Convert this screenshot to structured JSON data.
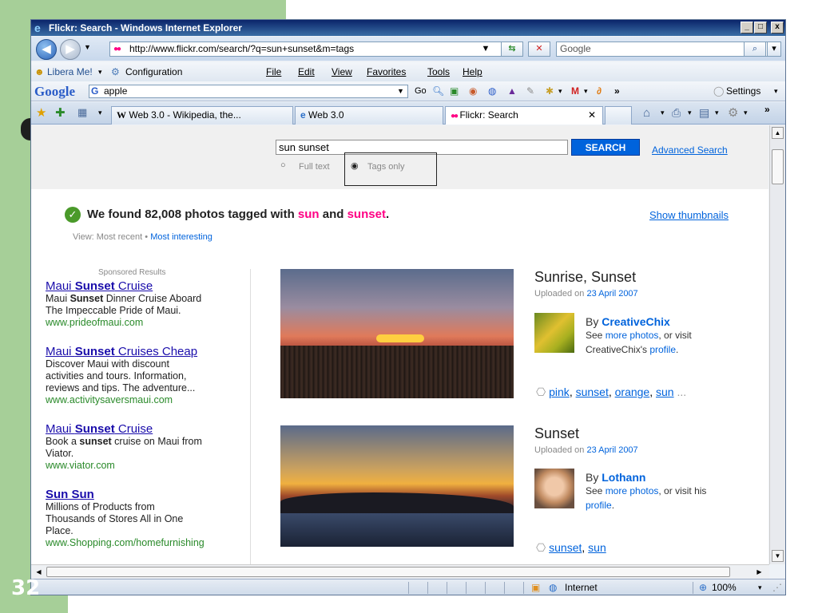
{
  "slide": {
    "number": "32"
  },
  "window": {
    "title": "Flickr: Search - Windows Internet Explorer",
    "minimize": "_",
    "maximize": "□",
    "close": "x"
  },
  "address": {
    "url": "http://www.flickr.com/search/?q=sun+sunset&m=tags",
    "search_placeholder": "Google"
  },
  "links_bar": {
    "libera": "Libera Me!",
    "configuration": "Configuration",
    "menu": [
      "File",
      "Edit",
      "View",
      "Favorites",
      "Tools",
      "Help"
    ]
  },
  "google_toolbar": {
    "logo": "Google",
    "query": "apple",
    "go": "Go",
    "more": "»",
    "settings": "Settings"
  },
  "tabs": [
    {
      "label": "Web 3.0 - Wikipedia, the..."
    },
    {
      "label": "Web 3.0"
    },
    {
      "label": "Flickr: Search"
    }
  ],
  "search": {
    "query": "sun sunset",
    "button": "SEARCH",
    "advanced": "Advanced Search",
    "option_full": "Full text",
    "option_tags": "Tags only",
    "selected_option": "Tags only"
  },
  "results": {
    "prefix": "We found 82,008 photos tagged with ",
    "tag1": "sun",
    "and": " and ",
    "tag2": "sunset",
    "period": ".",
    "show_thumbnails": "Show thumbnails",
    "view_label": "View: Most recent",
    "view_sep": " • ",
    "view_interesting": "Most interesting"
  },
  "sponsored": {
    "heading": "Sponsored Results",
    "ads": [
      {
        "title_pre": "Maui ",
        "title_bold": "Sunset",
        "title_post": " Cruise",
        "line1_pre": "Maui ",
        "line1_bold": "Sunset",
        "line1_post": " Dinner Cruise Aboard",
        "line2": "The Impeccable Pride of Maui.",
        "url": "www.prideofmaui.com"
      },
      {
        "title_pre": "Maui ",
        "title_bold": "Sunset",
        "title_post": " Cruises Cheap",
        "line1": "Discover Maui with discount",
        "line2": "activities and tours. Information,",
        "line3": "reviews and tips. The adventure...",
        "url": "www.activitysaversmaui.com"
      },
      {
        "title_pre": "Maui ",
        "title_bold": "Sunset",
        "title_post": " Cruise",
        "line1_pre": "Book a ",
        "line1_bold": "sunset",
        "line1_post": " cruise on Maui from",
        "line2": "Viator.",
        "url": "www.viator.com"
      },
      {
        "title_bold": "Sun Sun",
        "line1": "Millions of Products from",
        "line2": "Thousands of Stores All in One",
        "line3": "Place.",
        "url": "www.Shopping.com/homefurnishing"
      }
    ]
  },
  "photos": [
    {
      "title": "Sunrise, Sunset",
      "uploaded_prefix": "Uploaded on ",
      "date": "23 April 2007",
      "by_prefix": "By ",
      "author": "CreativeChix",
      "see": "See ",
      "more_photos": "more photos",
      "visit": ", or visit",
      "owner_text": "CreativeChix's ",
      "profile": "profile",
      "end": ".",
      "tags": [
        "pink",
        "sunset",
        "orange",
        "sun"
      ],
      "tags_more": "..."
    },
    {
      "title": "Sunset",
      "uploaded_prefix": "Uploaded on ",
      "date": "23 April 2007",
      "by_prefix": "By ",
      "author": "Lothann",
      "see": "See ",
      "more_photos": "more photos",
      "visit": ", or visit his",
      "profile": "profile",
      "end": ".",
      "tags": [
        "sunset",
        "sun"
      ]
    }
  ],
  "status": {
    "zone": "Internet",
    "zoom": "100%"
  },
  "colors": {
    "flickr_blue": "#0063dc",
    "flickr_pink": "#ff0084",
    "slide_green": "#a6cf98"
  }
}
